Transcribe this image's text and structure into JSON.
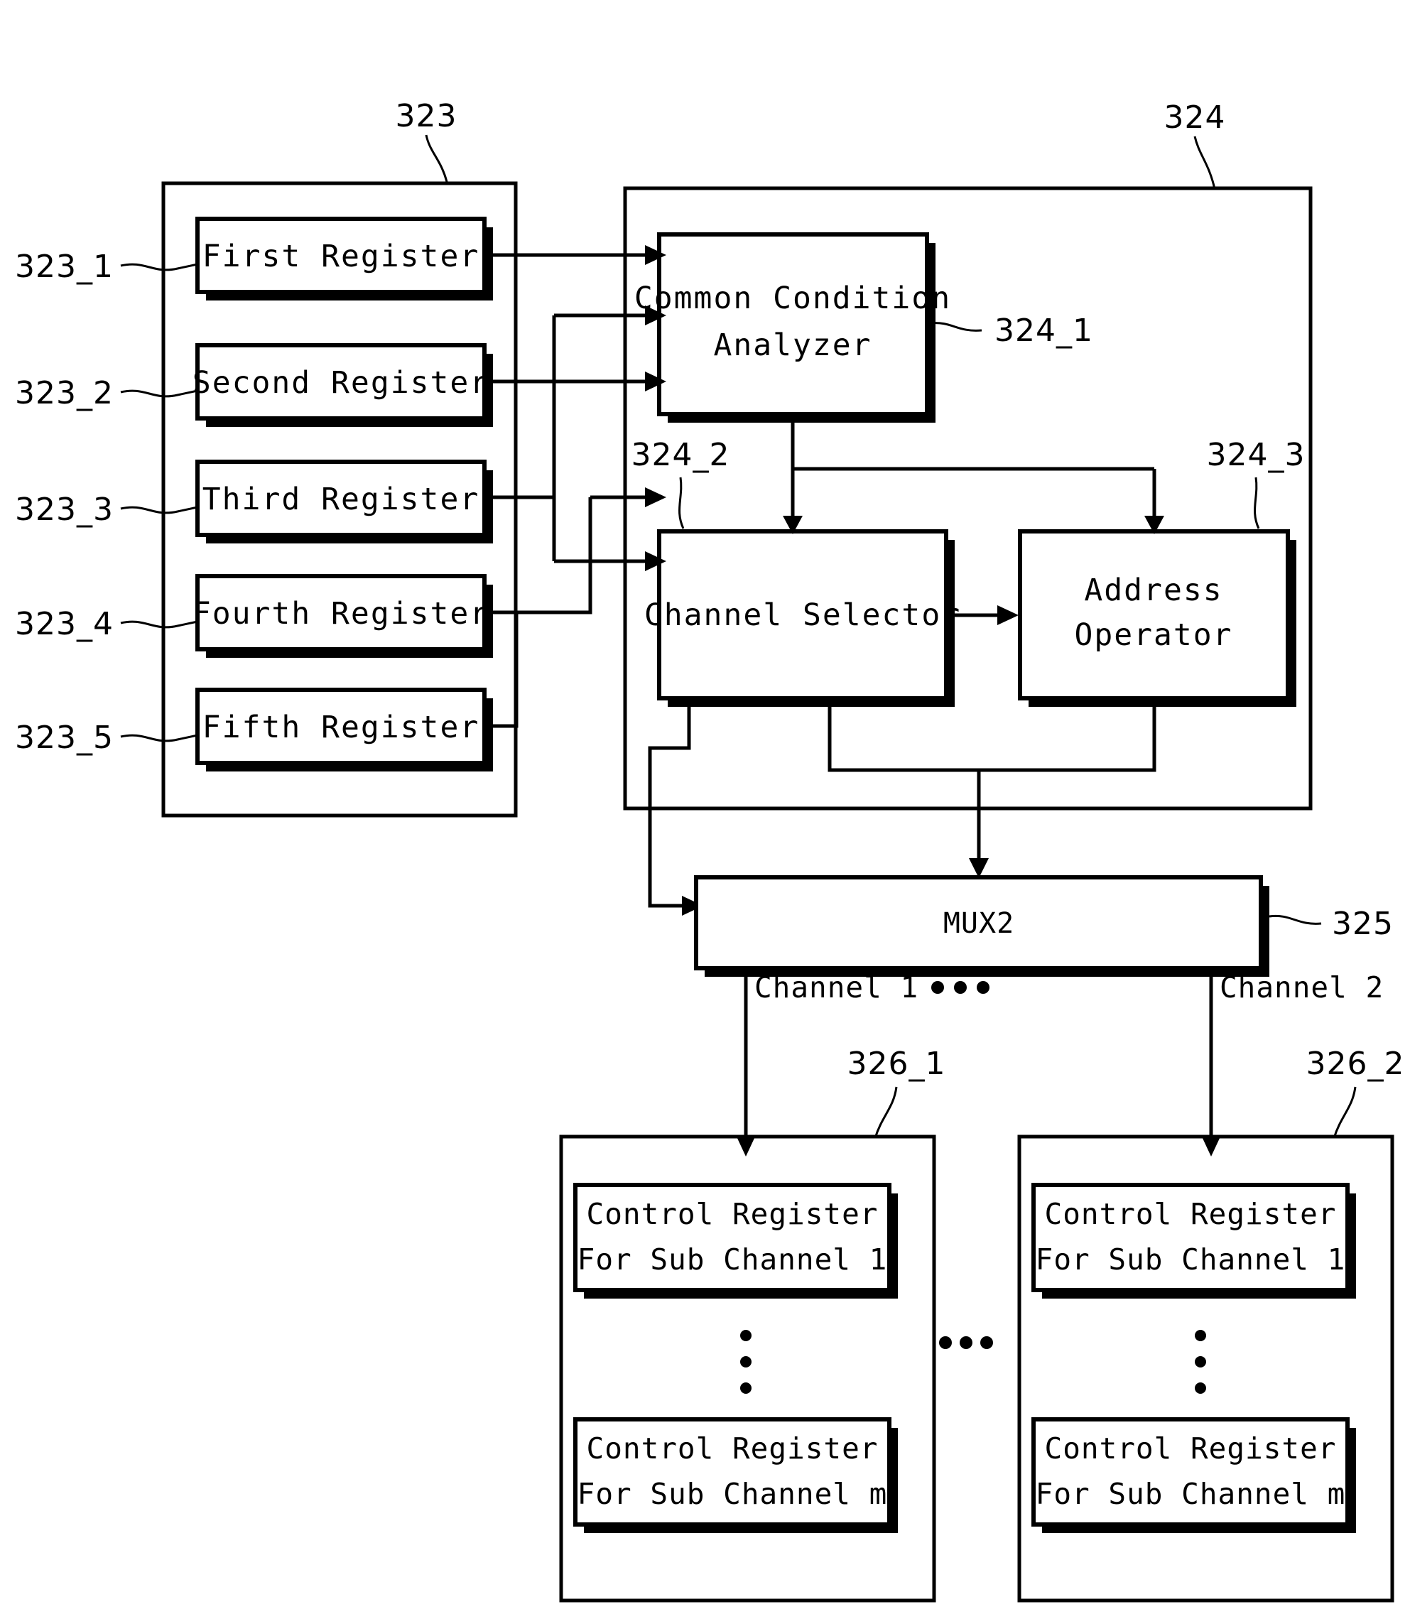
{
  "figure": {
    "type": "block-diagram",
    "background": "#ffffff",
    "line_color": "#000000"
  },
  "panels": {
    "register_file": {
      "ref": "323",
      "registers": [
        {
          "ref": "323_1",
          "label": "First Register"
        },
        {
          "ref": "323_2",
          "label": "Second Register"
        },
        {
          "ref": "323_3",
          "label": "Third Register"
        },
        {
          "ref": "323_4",
          "label": "Fourth Register"
        },
        {
          "ref": "323_5",
          "label": "Fifth Register"
        }
      ]
    },
    "controller": {
      "ref": "324",
      "blocks": [
        {
          "ref": "324_1",
          "line1": "Common Condition",
          "line2": "Analyzer"
        },
        {
          "ref": "324_2",
          "line1": "Channel Selector",
          "line2": ""
        },
        {
          "ref": "324_3",
          "line1": "Address",
          "line2": "Operator"
        }
      ]
    }
  },
  "mux": {
    "ref": "325",
    "label": "MUX2"
  },
  "channels": {
    "left_label": "Channel 1",
    "right_label": "Channel 2",
    "ellipsis": "• • •"
  },
  "channel_blocks": [
    {
      "ref": "326_1",
      "registers": [
        {
          "line1": "Control Register",
          "line2": "For Sub Channel 1"
        },
        {
          "line1": "Control Register",
          "line2": "For Sub Channel m"
        }
      ],
      "vertical_ellipsis": "⋮"
    },
    {
      "ref": "326_2",
      "registers": [
        {
          "line1": "Control Register",
          "line2": "For Sub Channel 1"
        },
        {
          "line1": "Control Register",
          "line2": "For Sub Channel m"
        }
      ],
      "vertical_ellipsis": "⋮"
    }
  ],
  "between_channel_blocks_ellipsis": "• • •"
}
